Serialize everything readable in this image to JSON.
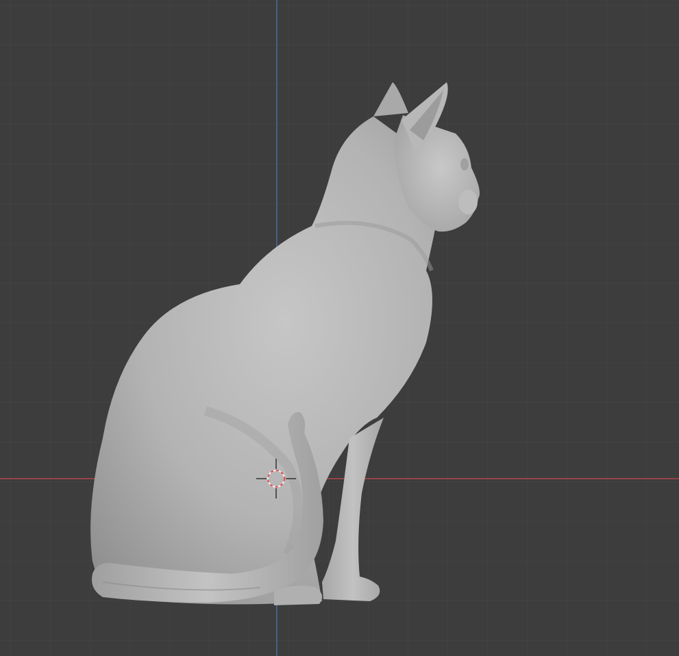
{
  "viewport": {
    "view": "orthographic-side",
    "background_color": "#3d3d3d",
    "grid_minor_color": "#474747",
    "grid_major_color": "#555555",
    "x_axis_color": "#d04a4e",
    "z_axis_color": "#4a73b0"
  },
  "object": {
    "kind": "sculpted-cat-model",
    "material_color": "#b4b4b4"
  },
  "cursor": {
    "icon": "3d-cursor-icon",
    "ring_colors": [
      "#e64a4a",
      "#f2f2f2"
    ]
  }
}
